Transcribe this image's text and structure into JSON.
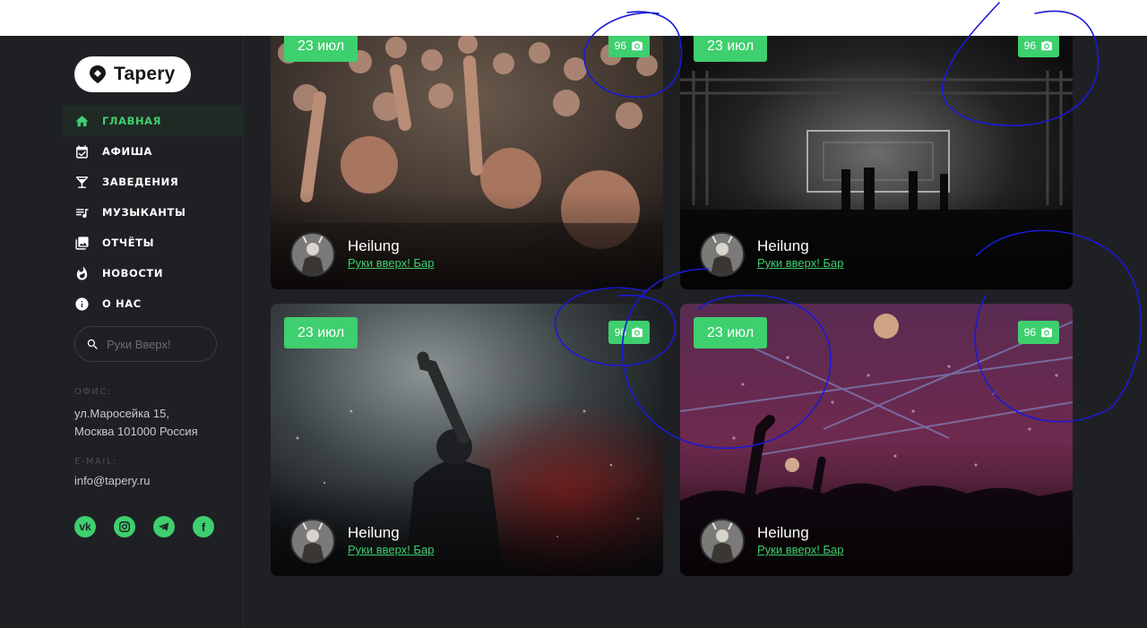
{
  "brand": {
    "name": "Tapery",
    "accent": "#3ecf6e"
  },
  "nav": [
    {
      "label": "ГЛАВНАЯ",
      "icon": "home-icon",
      "active": true
    },
    {
      "label": "АФИША",
      "icon": "calendar-icon",
      "active": false
    },
    {
      "label": "ЗАВЕДЕНИЯ",
      "icon": "cocktail-icon",
      "active": false
    },
    {
      "label": "МУЗЫКАНТЫ",
      "icon": "playlist-icon",
      "active": false
    },
    {
      "label": "ОТЧЁТЫ",
      "icon": "photo-library-icon",
      "active": false
    },
    {
      "label": "НОВОСТИ",
      "icon": "fire-icon",
      "active": false
    },
    {
      "label": "О НАС",
      "icon": "info-icon",
      "active": false
    }
  ],
  "search": {
    "placeholder": "Руки Вверх!"
  },
  "contacts": {
    "office_label": "ОФИС:",
    "address_line1": "ул.Маросейка 15,",
    "address_line2": "Москва 101000 Россия",
    "email_label": "E-MAIL:",
    "email": "info@tapery.ru"
  },
  "socials": [
    "vk-icon",
    "instagram-icon",
    "telegram-icon",
    "facebook-icon"
  ],
  "events": [
    {
      "date": "23 июл",
      "photos": "96",
      "artist": "Heilung",
      "venue": "Руки вверх! Бар",
      "scene": "crowd"
    },
    {
      "date": "23 июл",
      "photos": "96",
      "artist": "Heilung",
      "venue": "Руки вверх! Бар",
      "scene": "stage"
    },
    {
      "date": "23 июл",
      "photos": "96",
      "artist": "Heilung",
      "venue": "Руки вверх! Бар",
      "scene": "singer"
    },
    {
      "date": "23 июл",
      "photos": "96",
      "artist": "Heilung",
      "venue": "Руки вверх! Бар",
      "scene": "confetti"
    }
  ]
}
